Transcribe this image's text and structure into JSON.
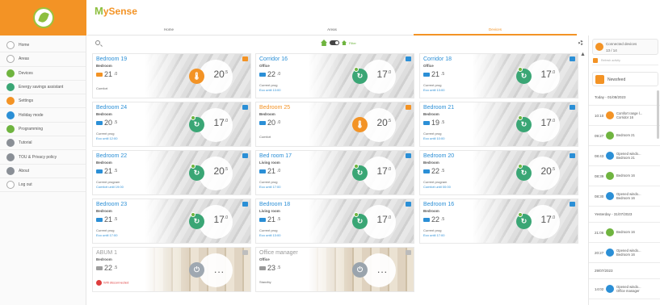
{
  "brand": {
    "logo_name": "MySense"
  },
  "sidebar": {
    "items": [
      {
        "label": "Home",
        "icon": "home-icon",
        "style": "outline"
      },
      {
        "label": "Areas",
        "icon": "areas-icon",
        "style": "outline"
      },
      {
        "label": "Devices",
        "icon": "devices-icon",
        "style": "green"
      },
      {
        "label": "Energy savings assistant",
        "icon": "leaf-icon",
        "style": "teal"
      },
      {
        "label": "Settings",
        "icon": "gear-icon",
        "style": "orange"
      },
      {
        "label": "Holiday mode",
        "icon": "holiday-icon",
        "style": "blue"
      },
      {
        "label": "Programming",
        "icon": "clock-icon",
        "style": "green"
      },
      {
        "label": "Tutorial",
        "icon": "tutorial-icon",
        "style": "gray"
      },
      {
        "label": "TOU & Privacy policy",
        "icon": "policy-icon",
        "style": "gray"
      },
      {
        "label": "About",
        "icon": "info-icon",
        "style": "gray"
      },
      {
        "label": "Log out",
        "icon": "logout-icon",
        "style": "outline"
      }
    ]
  },
  "header": {
    "tabs": [
      {
        "label": "Home",
        "active": false
      },
      {
        "label": "Areas",
        "active": false
      },
      {
        "label": "Devices",
        "active": true
      }
    ]
  },
  "toolbar": {
    "filter_label": "Filter"
  },
  "devices": [
    {
      "name": "Bedroom 19",
      "title_color": "blue",
      "room": "Bedroom",
      "temp_icon": "orange",
      "temp": "21",
      "temp_dec": ".0",
      "line1": "Comfort",
      "line2": "",
      "mode": "comfort",
      "mode_glyph": "🌡",
      "setpoint": "20",
      "setpoint_dec": ".5",
      "corner": "orange",
      "bg": "gray"
    },
    {
      "name": "Corridor 16",
      "title_color": "blue",
      "room": "Office",
      "temp_icon": "blue",
      "temp": "22",
      "temp_dec": ".0",
      "line1": "Current prog",
      "line2": "Eco until 13:00",
      "mode": "prog",
      "mode_glyph": "↻",
      "setpoint": "17",
      "setpoint_dec": ".0",
      "corner": "blue",
      "bg": "gray"
    },
    {
      "name": "Corridor 18",
      "title_color": "blue",
      "room": "Office",
      "temp_icon": "blue",
      "temp": "21",
      "temp_dec": ".5",
      "line1": "Current prog",
      "line2": "Eco until 13:00",
      "mode": "prog",
      "mode_glyph": "↻",
      "setpoint": "17",
      "setpoint_dec": ".0",
      "corner": "blue",
      "bg": "gray"
    },
    {
      "name": "Bedroom 24",
      "title_color": "blue",
      "room": "Bedroom",
      "temp_icon": "blue",
      "temp": "20",
      "temp_dec": ".5",
      "line1": "Current prog",
      "line2": "Eco until 12:00",
      "mode": "prog",
      "mode_glyph": "↻",
      "setpoint": "17",
      "setpoint_dec": ".0",
      "corner": "blue",
      "bg": "gray"
    },
    {
      "name": "Bedroom 25",
      "title_color": "orange",
      "room": "Bedroom",
      "temp_icon": "blue",
      "temp": "20",
      "temp_dec": ".0",
      "line1": "Comfort",
      "line2": "",
      "mode": "comfort",
      "mode_glyph": "🌡",
      "setpoint": "20",
      "setpoint_dec": ".5",
      "corner": "orange",
      "bg": "gray"
    },
    {
      "name": "Bedroom 21",
      "title_color": "blue",
      "room": "Bedroom",
      "temp_icon": "blue",
      "temp": "19",
      "temp_dec": ".5",
      "line1": "Current prog",
      "line2": "Eco until 10:00",
      "mode": "prog",
      "mode_glyph": "↻",
      "setpoint": "17",
      "setpoint_dec": ".0",
      "corner": "blue",
      "bg": "gray"
    },
    {
      "name": "Bedroom 22",
      "title_color": "blue",
      "room": "Bedroom",
      "temp_icon": "blue",
      "temp": "21",
      "temp_dec": ".5",
      "line1": "Current program",
      "line2": "Comfort until 19:00",
      "mode": "prog",
      "mode_glyph": "↻",
      "setpoint": "20",
      "setpoint_dec": ".5",
      "corner": "blue",
      "bg": "gray"
    },
    {
      "name": "Bed room 17",
      "title_color": "blue",
      "room": "Living room",
      "temp_icon": "blue",
      "temp": "21",
      "temp_dec": ".0",
      "line1": "Current prog",
      "line2": "Eco until 17:00",
      "mode": "prog",
      "mode_glyph": "↻",
      "setpoint": "17",
      "setpoint_dec": ".0",
      "corner": "blue",
      "bg": "gray"
    },
    {
      "name": "Bedroom 20",
      "title_color": "blue",
      "room": "Bedroom",
      "temp_icon": "blue",
      "temp": "22",
      "temp_dec": ".5",
      "line1": "Current program",
      "line2": "Comfort until 00:00",
      "mode": "prog",
      "mode_glyph": "↻",
      "setpoint": "20",
      "setpoint_dec": ".5",
      "corner": "blue",
      "bg": "gray"
    },
    {
      "name": "Bedroom 23",
      "title_color": "blue",
      "room": "Bedroom",
      "temp_icon": "blue",
      "temp": "21",
      "temp_dec": ".5",
      "line1": "Current prog",
      "line2": "Eco until 17:00",
      "mode": "prog",
      "mode_glyph": "↻",
      "setpoint": "17",
      "setpoint_dec": ".0",
      "corner": "blue",
      "bg": "gray"
    },
    {
      "name": "Bedroom 18",
      "title_color": "blue",
      "room": "Living room",
      "temp_icon": "blue",
      "temp": "21",
      "temp_dec": ".5",
      "line1": "Current prog",
      "line2": "Eco until 13:00",
      "mode": "prog",
      "mode_glyph": "↻",
      "setpoint": "17",
      "setpoint_dec": ".0",
      "corner": "blue",
      "bg": "gray"
    },
    {
      "name": "Bedroom 16",
      "title_color": "blue",
      "room": "Bedroom",
      "temp_icon": "blue",
      "temp": "22",
      "temp_dec": ".5",
      "line1": "Current prog",
      "line2": "Eco until 17:00",
      "mode": "prog",
      "mode_glyph": "↻",
      "setpoint": "17",
      "setpoint_dec": ".0",
      "corner": "blue",
      "bg": "gray"
    },
    {
      "name": "ABUM 1",
      "title_color": "gray",
      "room": "Bedroom",
      "temp_icon": "gray",
      "temp": "22",
      "temp_dec": ".5",
      "line1": "Wifi disconnected",
      "line2": "",
      "mode": "off",
      "mode_glyph": "⏻",
      "setpoint": "",
      "setpoint_dec": "",
      "more": "...",
      "corner": "gray",
      "bg": "wood",
      "offline": true
    },
    {
      "name": "Office manager",
      "title_color": "gray",
      "room": "Office",
      "temp_icon": "gray",
      "temp": "23",
      "temp_dec": ".5",
      "line1": "Standby",
      "line2": "",
      "mode": "off",
      "mode_glyph": "⏻",
      "setpoint": "",
      "setpoint_dec": "",
      "more": "...",
      "corner": "gray",
      "bg": "wood"
    }
  ],
  "right_panel": {
    "connected_label": "Connected devices",
    "connected_count": "13 / 14",
    "refresh_text": "Refresh activity",
    "newsfeed_label": "Newsfeed",
    "feed": [
      {
        "type": "date",
        "text": "Today - 01/08/2023"
      },
      {
        "type": "event",
        "time": "10:10",
        "icon": "orange",
        "text": "Comfort range l...",
        "sub": "Corridor 16"
      },
      {
        "type": "event",
        "time": "09:27",
        "icon": "green",
        "text": "Bedroom 21",
        "sub": ""
      },
      {
        "type": "event",
        "time": "08:43",
        "icon": "blue",
        "text": "Opened windo...",
        "sub": "Bedroom 21"
      },
      {
        "type": "event",
        "time": "08:39",
        "icon": "green",
        "text": "Bedroom 16",
        "sub": ""
      },
      {
        "type": "event",
        "time": "08:30",
        "icon": "blue",
        "text": "Opened windo...",
        "sub": "Bedroom 16"
      },
      {
        "type": "date",
        "text": "Yesterday - 31/07/2023"
      },
      {
        "type": "event",
        "time": "21:06",
        "icon": "green",
        "text": "Bedroom 16",
        "sub": ""
      },
      {
        "type": "event",
        "time": "20:27",
        "icon": "blue",
        "text": "Opened windo...",
        "sub": "Bedroom 16"
      },
      {
        "type": "date",
        "text": "29/07/2023"
      },
      {
        "type": "event",
        "time": "14:02",
        "icon": "blue",
        "text": "Opened windo...",
        "sub": "Office manager"
      }
    ]
  }
}
